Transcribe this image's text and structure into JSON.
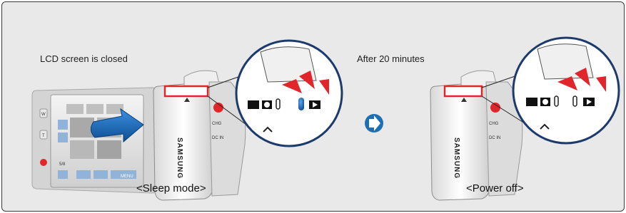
{
  "left_panel": {
    "label": "LCD screen is closed",
    "caption": "<Sleep mode>",
    "lcd_menu_text": "MENU",
    "lcd_button_labels": [
      "W",
      "T",
      "5/8"
    ],
    "brand_text": "SAMSUNG",
    "side_labels": [
      "CHG",
      "DC IN"
    ]
  },
  "right_panel": {
    "label": "After 20 minutes",
    "caption": "<Power off>",
    "brand_text": "SAMSUNG",
    "side_labels": [
      "CHG",
      "DC IN"
    ]
  },
  "colors": {
    "background": "#e9e9e9",
    "border": "#3b3b3b",
    "highlight_red": "#e0262b",
    "arrow_blue": "#1c6fb5",
    "led_blue": "#1f5fc4"
  },
  "icons": [
    "hand-push-arrow-icon",
    "next-arrow-icon",
    "movie-mode-icon",
    "photo-mode-icon",
    "play-mode-icon"
  ]
}
